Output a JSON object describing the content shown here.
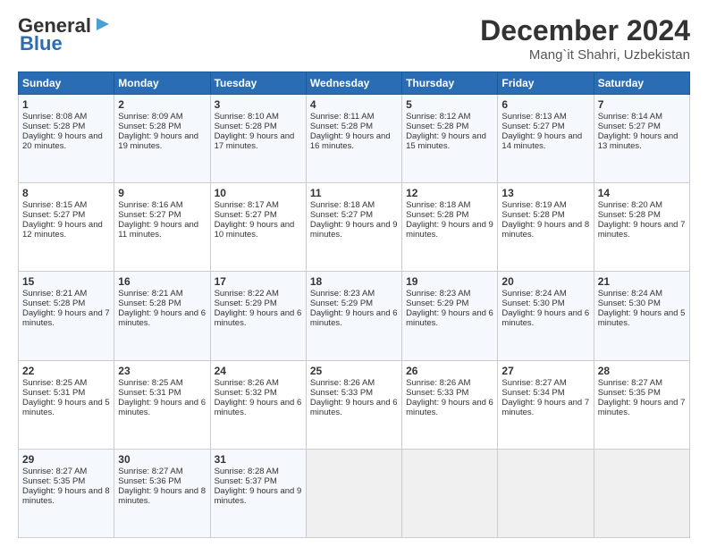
{
  "logo": {
    "line1": "General",
    "line2": "Blue"
  },
  "header": {
    "month": "December 2024",
    "location": "Mang`it Shahri, Uzbekistan"
  },
  "weekdays": [
    "Sunday",
    "Monday",
    "Tuesday",
    "Wednesday",
    "Thursday",
    "Friday",
    "Saturday"
  ],
  "weeks": [
    [
      {
        "day": "1",
        "sunrise": "Sunrise: 8:08 AM",
        "sunset": "Sunset: 5:28 PM",
        "daylight": "Daylight: 9 hours and 20 minutes."
      },
      {
        "day": "2",
        "sunrise": "Sunrise: 8:09 AM",
        "sunset": "Sunset: 5:28 PM",
        "daylight": "Daylight: 9 hours and 19 minutes."
      },
      {
        "day": "3",
        "sunrise": "Sunrise: 8:10 AM",
        "sunset": "Sunset: 5:28 PM",
        "daylight": "Daylight: 9 hours and 17 minutes."
      },
      {
        "day": "4",
        "sunrise": "Sunrise: 8:11 AM",
        "sunset": "Sunset: 5:28 PM",
        "daylight": "Daylight: 9 hours and 16 minutes."
      },
      {
        "day": "5",
        "sunrise": "Sunrise: 8:12 AM",
        "sunset": "Sunset: 5:28 PM",
        "daylight": "Daylight: 9 hours and 15 minutes."
      },
      {
        "day": "6",
        "sunrise": "Sunrise: 8:13 AM",
        "sunset": "Sunset: 5:27 PM",
        "daylight": "Daylight: 9 hours and 14 minutes."
      },
      {
        "day": "7",
        "sunrise": "Sunrise: 8:14 AM",
        "sunset": "Sunset: 5:27 PM",
        "daylight": "Daylight: 9 hours and 13 minutes."
      }
    ],
    [
      {
        "day": "8",
        "sunrise": "Sunrise: 8:15 AM",
        "sunset": "Sunset: 5:27 PM",
        "daylight": "Daylight: 9 hours and 12 minutes."
      },
      {
        "day": "9",
        "sunrise": "Sunrise: 8:16 AM",
        "sunset": "Sunset: 5:27 PM",
        "daylight": "Daylight: 9 hours and 11 minutes."
      },
      {
        "day": "10",
        "sunrise": "Sunrise: 8:17 AM",
        "sunset": "Sunset: 5:27 PM",
        "daylight": "Daylight: 9 hours and 10 minutes."
      },
      {
        "day": "11",
        "sunrise": "Sunrise: 8:18 AM",
        "sunset": "Sunset: 5:27 PM",
        "daylight": "Daylight: 9 hours and 9 minutes."
      },
      {
        "day": "12",
        "sunrise": "Sunrise: 8:18 AM",
        "sunset": "Sunset: 5:28 PM",
        "daylight": "Daylight: 9 hours and 9 minutes."
      },
      {
        "day": "13",
        "sunrise": "Sunrise: 8:19 AM",
        "sunset": "Sunset: 5:28 PM",
        "daylight": "Daylight: 9 hours and 8 minutes."
      },
      {
        "day": "14",
        "sunrise": "Sunrise: 8:20 AM",
        "sunset": "Sunset: 5:28 PM",
        "daylight": "Daylight: 9 hours and 7 minutes."
      }
    ],
    [
      {
        "day": "15",
        "sunrise": "Sunrise: 8:21 AM",
        "sunset": "Sunset: 5:28 PM",
        "daylight": "Daylight: 9 hours and 7 minutes."
      },
      {
        "day": "16",
        "sunrise": "Sunrise: 8:21 AM",
        "sunset": "Sunset: 5:28 PM",
        "daylight": "Daylight: 9 hours and 6 minutes."
      },
      {
        "day": "17",
        "sunrise": "Sunrise: 8:22 AM",
        "sunset": "Sunset: 5:29 PM",
        "daylight": "Daylight: 9 hours and 6 minutes."
      },
      {
        "day": "18",
        "sunrise": "Sunrise: 8:23 AM",
        "sunset": "Sunset: 5:29 PM",
        "daylight": "Daylight: 9 hours and 6 minutes."
      },
      {
        "day": "19",
        "sunrise": "Sunrise: 8:23 AM",
        "sunset": "Sunset: 5:29 PM",
        "daylight": "Daylight: 9 hours and 6 minutes."
      },
      {
        "day": "20",
        "sunrise": "Sunrise: 8:24 AM",
        "sunset": "Sunset: 5:30 PM",
        "daylight": "Daylight: 9 hours and 6 minutes."
      },
      {
        "day": "21",
        "sunrise": "Sunrise: 8:24 AM",
        "sunset": "Sunset: 5:30 PM",
        "daylight": "Daylight: 9 hours and 5 minutes."
      }
    ],
    [
      {
        "day": "22",
        "sunrise": "Sunrise: 8:25 AM",
        "sunset": "Sunset: 5:31 PM",
        "daylight": "Daylight: 9 hours and 5 minutes."
      },
      {
        "day": "23",
        "sunrise": "Sunrise: 8:25 AM",
        "sunset": "Sunset: 5:31 PM",
        "daylight": "Daylight: 9 hours and 6 minutes."
      },
      {
        "day": "24",
        "sunrise": "Sunrise: 8:26 AM",
        "sunset": "Sunset: 5:32 PM",
        "daylight": "Daylight: 9 hours and 6 minutes."
      },
      {
        "day": "25",
        "sunrise": "Sunrise: 8:26 AM",
        "sunset": "Sunset: 5:33 PM",
        "daylight": "Daylight: 9 hours and 6 minutes."
      },
      {
        "day": "26",
        "sunrise": "Sunrise: 8:26 AM",
        "sunset": "Sunset: 5:33 PM",
        "daylight": "Daylight: 9 hours and 6 minutes."
      },
      {
        "day": "27",
        "sunrise": "Sunrise: 8:27 AM",
        "sunset": "Sunset: 5:34 PM",
        "daylight": "Daylight: 9 hours and 7 minutes."
      },
      {
        "day": "28",
        "sunrise": "Sunrise: 8:27 AM",
        "sunset": "Sunset: 5:35 PM",
        "daylight": "Daylight: 9 hours and 7 minutes."
      }
    ],
    [
      {
        "day": "29",
        "sunrise": "Sunrise: 8:27 AM",
        "sunset": "Sunset: 5:35 PM",
        "daylight": "Daylight: 9 hours and 8 minutes."
      },
      {
        "day": "30",
        "sunrise": "Sunrise: 8:27 AM",
        "sunset": "Sunset: 5:36 PM",
        "daylight": "Daylight: 9 hours and 8 minutes."
      },
      {
        "day": "31",
        "sunrise": "Sunrise: 8:28 AM",
        "sunset": "Sunset: 5:37 PM",
        "daylight": "Daylight: 9 hours and 9 minutes."
      },
      null,
      null,
      null,
      null
    ]
  ]
}
